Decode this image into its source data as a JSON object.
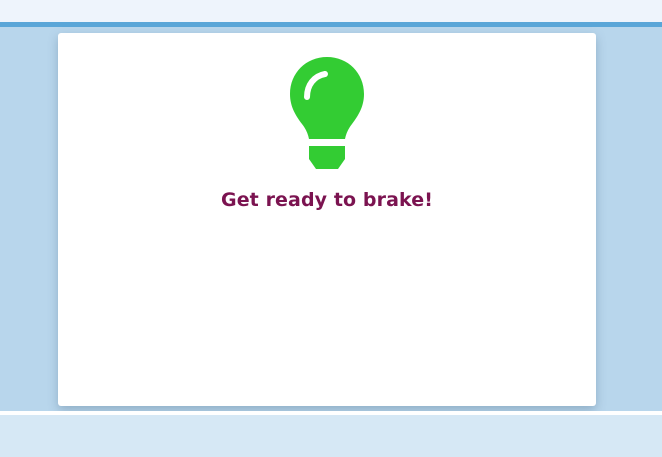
{
  "message": "Get ready to brake!",
  "icon": {
    "name": "lightbulb-icon",
    "color": "#33cc33"
  },
  "colors": {
    "message_text": "#7b1350",
    "background": "#b8d6ec",
    "top_accent": "#5aa6d8",
    "card": "#ffffff"
  }
}
